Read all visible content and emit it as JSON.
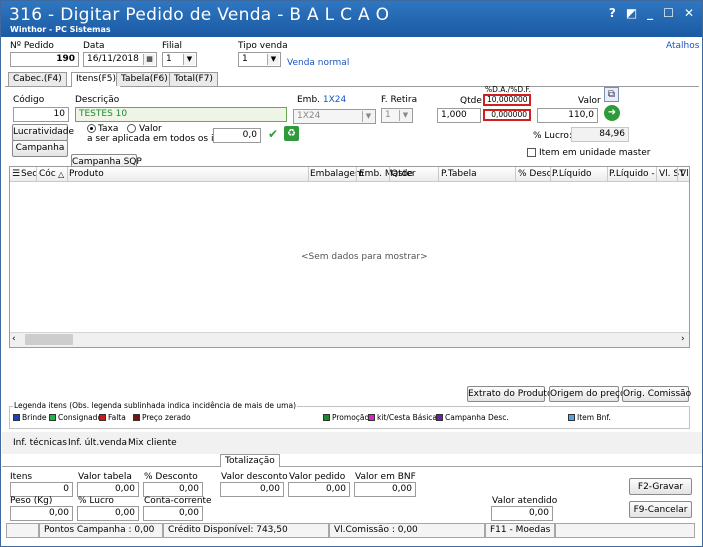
{
  "window": {
    "title": "316 - Digitar Pedido de Venda - B A L C A O",
    "subtitle": "Winthor - PC Sistemas",
    "controls": [
      "?",
      "◩",
      "_",
      "☐",
      "✕"
    ]
  },
  "header": {
    "atalhos": "Atalhos",
    "pedido_label": "Nº Pedido",
    "pedido_value": "190",
    "data_label": "Data",
    "data_value": "16/11/2018",
    "filial_label": "Filial",
    "filial_value": "1",
    "tipo_venda_label": "Tipo venda",
    "tipo_venda_value": "1",
    "tipo_venda_desc": "Venda normal"
  },
  "tabs": [
    "Cabec.(F4)",
    "Itens(F5)",
    "Tabela(F6)",
    "Total(F7)"
  ],
  "item": {
    "codigo_label": "Código",
    "codigo_value": "10",
    "descricao_label": "Descrição",
    "descricao_value": "TESTES 10",
    "emb_label": "Emb.",
    "emb_link": "1X24",
    "emb_value": "1X24",
    "fretira_label": "F. Retira",
    "fretira_value": "1",
    "qtde_label": "Qtde",
    "qtde_value": "1,000",
    "pct_label": "%D.A./%D.F.",
    "pct_da": "10,000000",
    "pct_df": "0,000000",
    "valor_label": "Valor",
    "valor_value": "110,0",
    "lucro_label": "% Lucro:",
    "lucro_value": "84,96",
    "unidade_master": "Item em unidade master"
  },
  "actions": {
    "lucratividade": "Lucratividade",
    "campanha": "Campanha",
    "campanha_sqp": "Campanha SQP"
  },
  "taxa": {
    "opt_taxa": "Taxa",
    "opt_valor": "Valor",
    "aplicar_label": "a ser aplicada em todos os itens:",
    "aplicar_value": "0,0"
  },
  "grid": {
    "columns": [
      "Sec",
      "Cóc",
      "Produto",
      "Embalagem",
      "Emb. Master",
      "Qtde",
      "P.Tabela",
      "% Desc.",
      "P.Líquido",
      "P.Líquido - S",
      "Vl. ST",
      "Vl."
    ],
    "empty_text": "<Sem dados para mostrar>"
  },
  "buttons": {
    "extrato": "Extrato do Produto",
    "origem": "Origem do preço",
    "orig_comissao": "Orig. Comissão",
    "f2": "F2-Gravar",
    "f9": "F9-Cancelar"
  },
  "legend": {
    "title": "Legenda itens (Obs. legenda sublinhada indica incidência de mais de uma)",
    "items": [
      {
        "label": "Brinde",
        "color": "#1f3fbf"
      },
      {
        "label": "Consignado",
        "color": "#22b14c"
      },
      {
        "label": "Falta",
        "color": "#d11919"
      },
      {
        "label": "Preço zerado",
        "color": "#7a1010"
      },
      {
        "label": "Promoção",
        "color": "#1b8a2e"
      },
      {
        "label": "kit/Cesta Básica",
        "color": "#e020c8"
      },
      {
        "label": "Campanha Desc.",
        "color": "#6a1fb0"
      },
      {
        "label": "Item Bnf.",
        "color": "#5aa0e6"
      }
    ]
  },
  "bottom_tabs": {
    "links": [
      "Inf. técnicas",
      "Inf. últ.venda",
      "Mix cliente"
    ],
    "totalizacao": "Totalização"
  },
  "totals": {
    "itens_label": "Itens",
    "itens_value": "0",
    "valor_tabela_label": "Valor tabela",
    "valor_tabela_value": "0,00",
    "desconto_label": "% Desconto",
    "desconto_value": "0,00",
    "valor_desconto_label": "Valor desconto",
    "valor_desconto_value": "0,00",
    "valor_pedido_label": "Valor pedido",
    "valor_pedido_value": "0,00",
    "valor_bnf_label": "Valor em BNF",
    "valor_bnf_value": "0,00",
    "peso_label": "Peso (Kg)",
    "peso_value": "0,00",
    "lucro_label": "% Lucro",
    "lucro_value": "0,00",
    "conta_label": "Conta-corrente",
    "conta_value": "0,00",
    "valor_atendido_label": "Valor atendido",
    "valor_atendido_value": "0,00"
  },
  "status": {
    "pontos": "Pontos Campanha : 0,00",
    "credito": "Crédito Disponível: 743,50",
    "comissao": "Vl.Comissão : 0,00",
    "f11": "F11 - Moedas"
  }
}
